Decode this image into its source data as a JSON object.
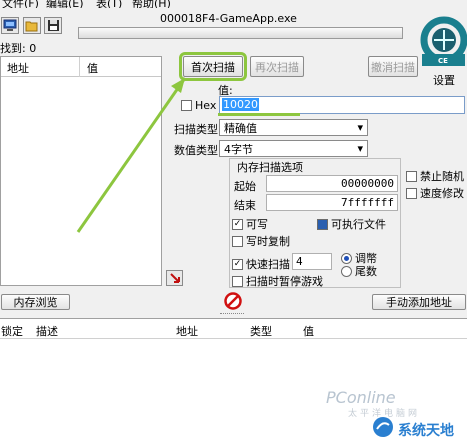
{
  "menu": {
    "items": [
      "文件(F)",
      "编辑(E)",
      "表(T)",
      "帮助(H)"
    ]
  },
  "window": {
    "process_title": "000018F4-GameApp.exe",
    "found_label": "找到: 0"
  },
  "result_list": {
    "columns": [
      "地址",
      "值"
    ]
  },
  "scan": {
    "first_scan": "首次扫描",
    "next_scan": "再次扫描",
    "undo_scan": "撤消扫描",
    "settings": "设置",
    "value_label": "值:",
    "hex_label": "Hex",
    "value": "10020",
    "scan_type_label": "扫描类型",
    "scan_type_value": "精确值",
    "value_type_label": "数值类型",
    "value_type_value": "4字节"
  },
  "memory_options": {
    "title": "内存扫描选项",
    "start_label": "起始",
    "start_value": "00000000",
    "stop_label": "结束",
    "stop_value": "7fffffff",
    "writable": "可写",
    "executable": "可执行文件",
    "copy_on_write": "写时复制",
    "fast_scan": "快速扫描",
    "fast_scan_value": "4",
    "alignment": "调幣",
    "last_digits": "尾数",
    "pause_game": "扫描时暂停游戏"
  },
  "side_options": {
    "disable_random": "禁止随机",
    "speedhack": "速度修改"
  },
  "actions": {
    "memory_view": "内存浏览",
    "add_address_manually": "手动添加地址"
  },
  "cheat_table": {
    "columns": [
      "锁定",
      "描述",
      "地址",
      "类型",
      "值"
    ]
  },
  "watermark": {
    "brand": "PConline",
    "sub": "太平洋电脑网",
    "site": "系统天地"
  },
  "colors": {
    "highlight": "#8dc63f",
    "selection": "#3399ff",
    "logo_teal": "#1a7f8e"
  }
}
